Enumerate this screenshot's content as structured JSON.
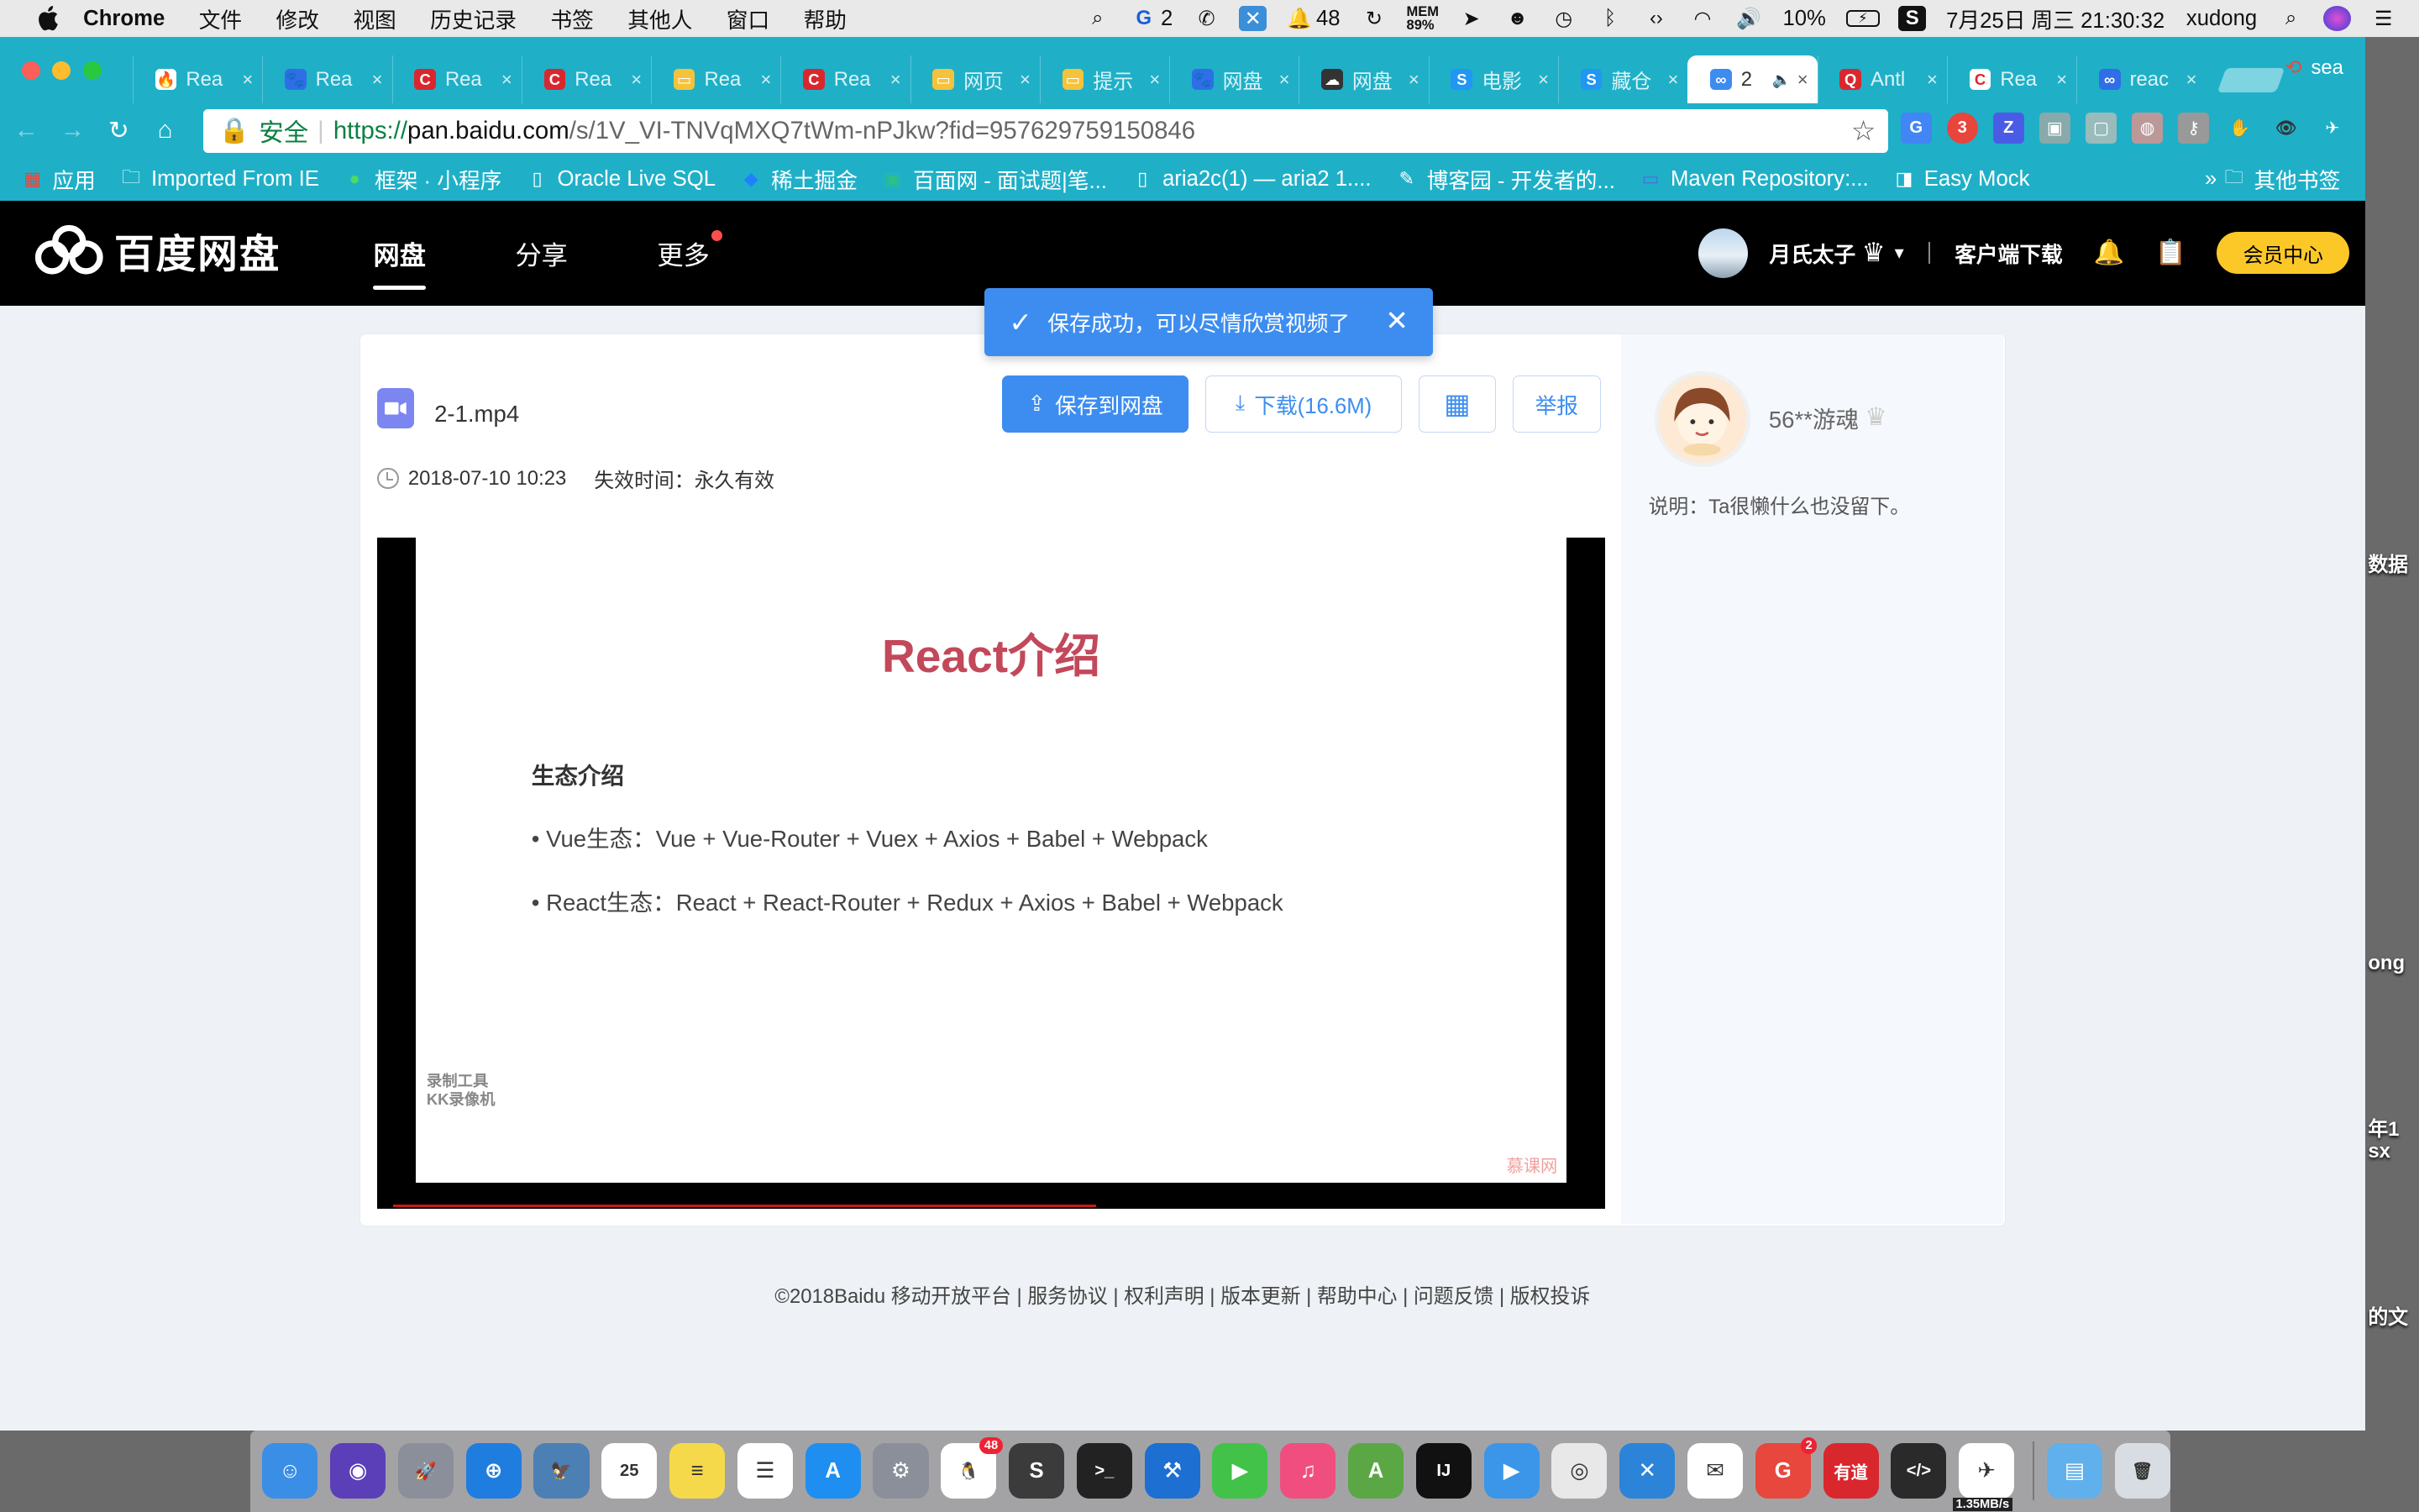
{
  "menubar": {
    "app": "Chrome",
    "items": [
      "文件",
      "修改",
      "视图",
      "历史记录",
      "书签",
      "其他人",
      "窗口",
      "帮助"
    ],
    "status": {
      "notif_count": "2",
      "qq_count": "48",
      "mem_label": "MEM",
      "mem_value": "89%",
      "battery": "10%",
      "datetime": "7月25日 周三  21:30:32",
      "user": "xudong"
    }
  },
  "browser": {
    "tabs": [
      {
        "title": "Rea",
        "icon_color": "#ffffff",
        "icon_glyph": "🔥"
      },
      {
        "title": "Rea",
        "icon_color": "#2f6ee6",
        "icon_glyph": "🐾"
      },
      {
        "title": "Rea",
        "icon_color": "#d9272e",
        "icon_glyph": "C"
      },
      {
        "title": "Rea",
        "icon_color": "#d9272e",
        "icon_glyph": "C"
      },
      {
        "title": "Rea",
        "icon_color": "#f5c33b",
        "icon_glyph": "▭"
      },
      {
        "title": "Rea",
        "icon_color": "#d9272e",
        "icon_glyph": "C"
      },
      {
        "title": "网页",
        "icon_color": "#f5c33b",
        "icon_glyph": "▭"
      },
      {
        "title": "提示",
        "icon_color": "#f5c33b",
        "icon_glyph": "▭"
      },
      {
        "title": "网盘",
        "icon_color": "#2f6ee6",
        "icon_glyph": "🐾"
      },
      {
        "title": "网盘",
        "icon_color": "#333333",
        "icon_glyph": "☁"
      },
      {
        "title": "电影",
        "icon_color": "#2196f3",
        "icon_glyph": "S"
      },
      {
        "title": "藏仓",
        "icon_color": "#2196f3",
        "icon_glyph": "S"
      },
      {
        "title": "2",
        "icon_color": "#3d8df0",
        "icon_glyph": "∞",
        "active": true,
        "audio_icon": "🔈"
      },
      {
        "title": "Antl",
        "icon_color": "#d9272e",
        "icon_glyph": "Q"
      },
      {
        "title": "Rea",
        "icon_color": "#ffffff",
        "icon_glyph": "C"
      },
      {
        "title": "reac",
        "icon_color": "#2f6ee6",
        "icon_glyph": "∞"
      }
    ],
    "profile_label": "sea",
    "url": {
      "secure_label": "安全",
      "protocol": "https://",
      "host": "pan.baidu.com",
      "path": "/s/1V_VI-TNVqMXQ7tWm-nPJkw?fid=957629759150846"
    },
    "bookmarks": [
      {
        "label": "应用",
        "icon": "apps-grid-icon"
      },
      {
        "label": "Imported From IE",
        "icon": "folder-icon"
      },
      {
        "label": "框架 · 小程序",
        "icon": "wechat-icon"
      },
      {
        "label": "Oracle Live SQL",
        "icon": "page-icon"
      },
      {
        "label": "稀土掘金",
        "icon": "juejin-icon"
      },
      {
        "label": "百面网 - 面试题|笔...",
        "icon": "bm-icon"
      },
      {
        "label": "aria2c(1) — aria2 1....",
        "icon": "page-icon"
      },
      {
        "label": "博客园 - 开发者的...",
        "icon": "cnblogs-icon"
      },
      {
        "label": "Maven Repository:...",
        "icon": "maven-icon"
      },
      {
        "label": "Easy Mock",
        "icon": "easymock-icon"
      }
    ],
    "bookmarks_overflow": "»",
    "other_bookmarks": "其他书签"
  },
  "baidu": {
    "logo_text": "百度网盘",
    "nav": [
      {
        "label": "网盘",
        "active": true
      },
      {
        "label": "分享",
        "active": false
      },
      {
        "label": "更多",
        "active": false,
        "dot": true
      }
    ],
    "user_name": "月氏太子",
    "client_download": "客户端下载",
    "vip_label": "会员中心"
  },
  "file": {
    "name": "2-1.mp4",
    "save_label": "保存到网盘",
    "download_label": "下载(16.6M)",
    "report_label": "举报",
    "date": "2018-07-10 10:23",
    "expire": "失效时间：永久有效"
  },
  "slide": {
    "title": "React介绍",
    "heading": "生态介绍",
    "bullets": [
      "• Vue生态：Vue + Vue-Router + Vuex + Axios + Babel + Webpack",
      "• React生态：React + React-Router + Redux + Axios + Babel + Webpack"
    ],
    "watermark_left": "录制工具\nKK录像机",
    "watermark_right": "慕课网"
  },
  "uploader": {
    "name": "56**游魂",
    "desc": "说明：Ta很懒什么也没留下。"
  },
  "toast": {
    "message": "保存成功，可以尽情欣赏视频了"
  },
  "footer": {
    "text": "©2018Baidu 移动开放平台 | 服务协议 | 权利声明 | 版本更新 | 帮助中心 | 问题反馈 | 版权投诉"
  },
  "desktop_fragments": [
    "数据",
    "ong",
    "年1",
    "sx",
    "的文"
  ],
  "dock": {
    "apps": [
      {
        "name": "finder",
        "color": "#3a8ee6",
        "glyph": "☺"
      },
      {
        "name": "siri",
        "color": "#5b3fb8",
        "glyph": "◉"
      },
      {
        "name": "launchpad",
        "color": "#8a8f99",
        "glyph": "🚀"
      },
      {
        "name": "safari",
        "color": "#1f7de0",
        "glyph": "⊕"
      },
      {
        "name": "preview",
        "color": "#4c7fb4",
        "glyph": "🦅"
      },
      {
        "name": "calendar",
        "color": "#ffffff",
        "glyph": "25"
      },
      {
        "name": "notes",
        "color": "#f6d94a",
        "glyph": "≡"
      },
      {
        "name": "reminders",
        "color": "#ffffff",
        "glyph": "☰"
      },
      {
        "name": "app-store",
        "color": "#1e8ff0",
        "glyph": "A"
      },
      {
        "name": "system-preferences",
        "color": "#8a8f99",
        "glyph": "⚙"
      },
      {
        "name": "qq",
        "color": "#ffffff",
        "glyph": "🐧",
        "badge": "48"
      },
      {
        "name": "sublime",
        "color": "#3b3b3b",
        "glyph": "S"
      },
      {
        "name": "terminal",
        "color": "#222222",
        "glyph": ">_"
      },
      {
        "name": "xcode",
        "color": "#1d6fd1",
        "glyph": "⚒"
      },
      {
        "name": "facetime",
        "color": "#43c24a",
        "glyph": "▶"
      },
      {
        "name": "itunes",
        "color": "#f04e7e",
        "glyph": "♫"
      },
      {
        "name": "android-studio",
        "color": "#5ba745",
        "glyph": "A"
      },
      {
        "name": "intellij",
        "color": "#111111",
        "glyph": "IJ"
      },
      {
        "name": "infuse",
        "color": "#3b95e8",
        "glyph": "▶"
      },
      {
        "name": "chrome",
        "color": "#e8e8e8",
        "glyph": "◎"
      },
      {
        "name": "xmind",
        "color": "#2b84d8",
        "glyph": "✕"
      },
      {
        "name": "wechat",
        "color": "#ffffff",
        "glyph": "✉"
      },
      {
        "name": "gitmind",
        "color": "#e7473c",
        "glyph": "G",
        "badge": "2"
      },
      {
        "name": "youdao",
        "color": "#d9272e",
        "glyph": "有道"
      },
      {
        "name": "code-editor",
        "color": "#2a2a2a",
        "glyph": "</>"
      },
      {
        "name": "feishu",
        "color": "#ffffff",
        "glyph": "✈"
      },
      {
        "name": "downloads-folder",
        "color": "#5fb0ec",
        "glyph": "▤"
      },
      {
        "name": "trash",
        "color": "#d8dde3",
        "glyph": "🗑"
      }
    ],
    "net_speed": "1.35MB/s"
  }
}
